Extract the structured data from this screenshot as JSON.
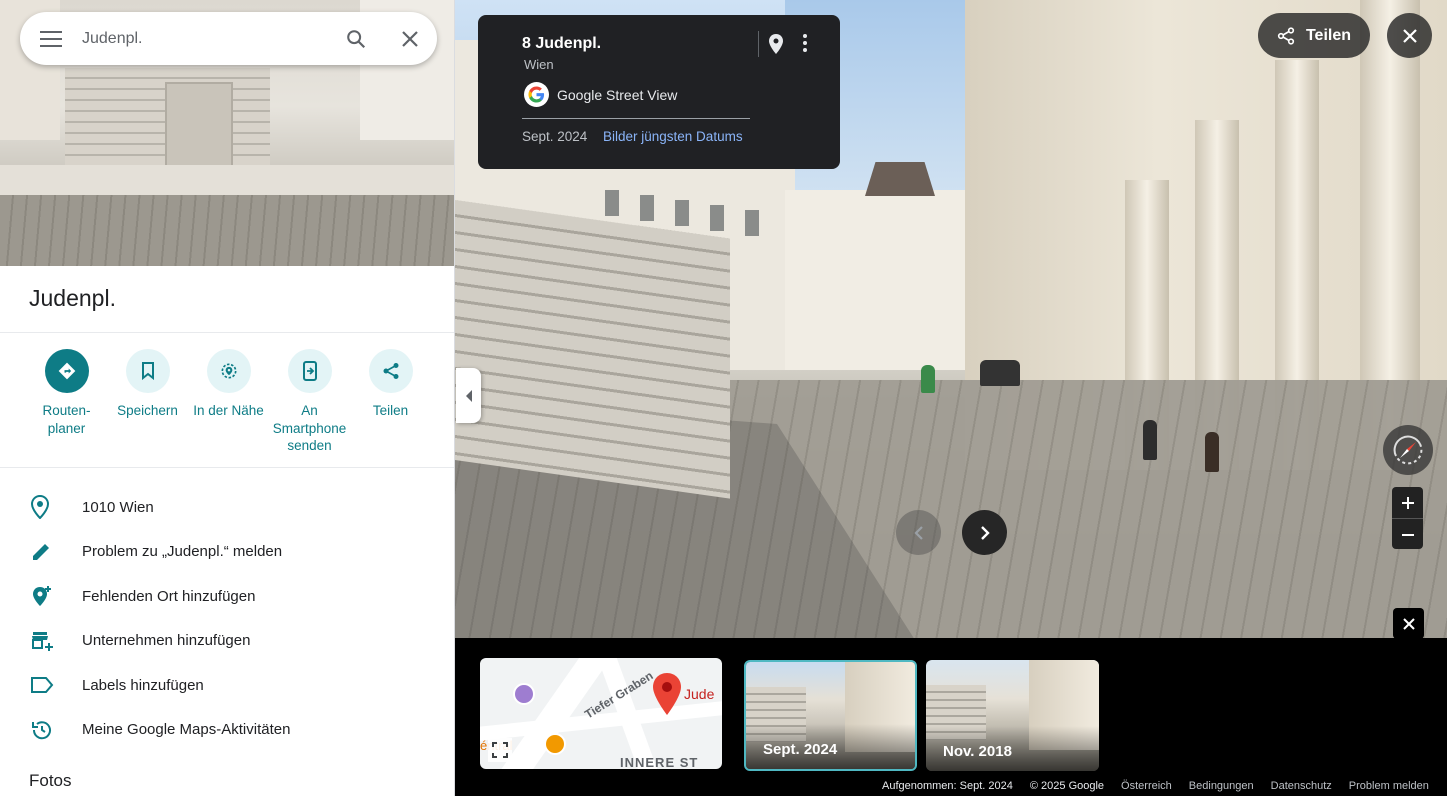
{
  "search": {
    "value": "Judenpl."
  },
  "place": {
    "title": "Judenpl.",
    "actions": [
      {
        "label": "Routen-\nplaner"
      },
      {
        "label": "Speichern"
      },
      {
        "label": "In der Nähe"
      },
      {
        "label": "An\nSmartphone\nsenden"
      },
      {
        "label": "Teilen"
      }
    ],
    "rows": [
      {
        "text": "1010 Wien"
      },
      {
        "text": "Problem zu „Judenpl.“ melden"
      },
      {
        "text": "Fehlenden Ort hinzufügen"
      },
      {
        "text": "Unternehmen hinzufügen"
      },
      {
        "text": "Labels hinzufügen"
      },
      {
        "text": "Meine Google Maps-Aktivitäten"
      }
    ],
    "photos_heading": "Fotos"
  },
  "card": {
    "title": "8 Judenpl.",
    "subtitle": "Wien",
    "source": "Google Street View",
    "date": "Sept. 2024",
    "newest_link": "Bilder jüngsten Datums"
  },
  "share_button": "Teilen",
  "minimap": {
    "street_label": "Tiefer Graben",
    "district_label": "INNERE ST",
    "place_label": "Jude",
    "poi_label": "éntral"
  },
  "timeline": [
    {
      "label": "Sept. 2024",
      "selected": true
    },
    {
      "label": "Nov. 2018",
      "selected": false
    }
  ],
  "footer": {
    "captured": "Aufgenommen: Sept. 2024",
    "copyright": "© 2025 Google",
    "country": "Österreich",
    "terms": "Bedingungen",
    "privacy": "Datenschutz",
    "report": "Problem melden"
  },
  "colors": {
    "accent": "#0e7c86",
    "accent_light": "#e3f4f6",
    "link": "#8ab4f8"
  }
}
